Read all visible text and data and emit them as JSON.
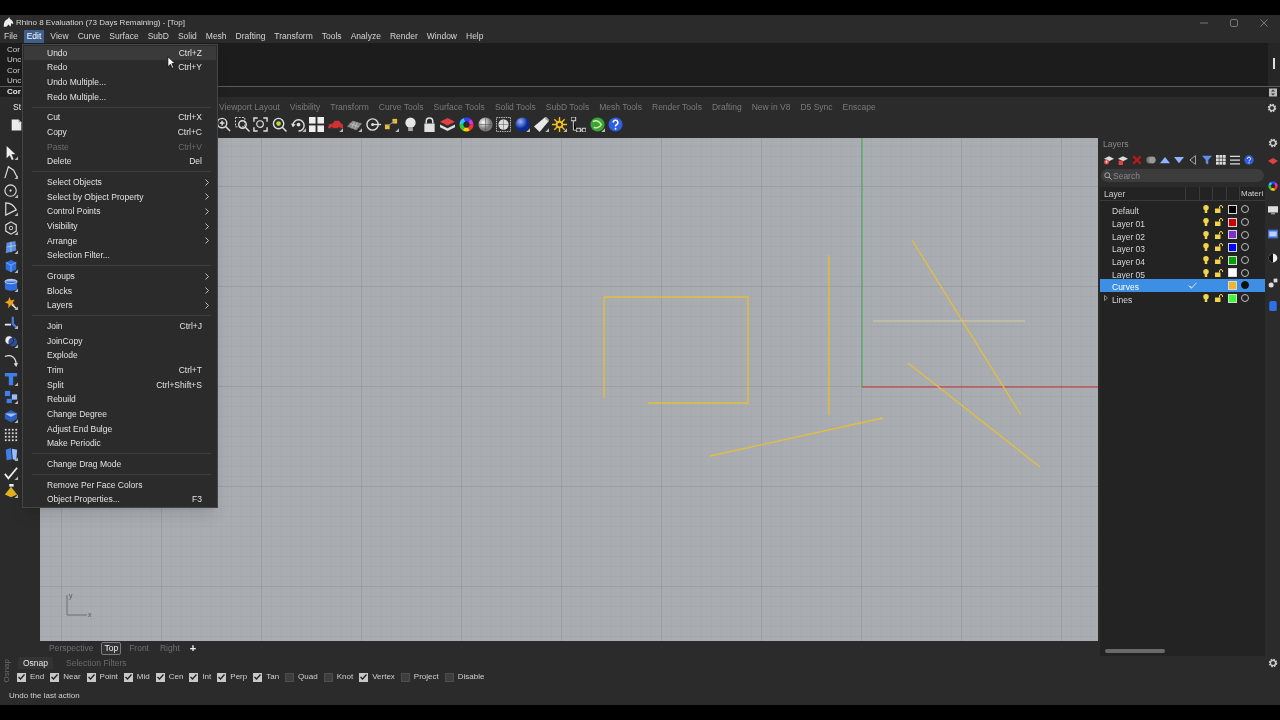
{
  "title_bar": {
    "title": "Rhino 8 Evaluation (73 Days Remaining) - [Top]"
  },
  "menu_bar": [
    {
      "label": "File",
      "selected": false
    },
    {
      "label": "Edit",
      "selected": true
    },
    {
      "label": "View",
      "selected": false
    },
    {
      "label": "Curve",
      "selected": false
    },
    {
      "label": "Surface",
      "selected": false
    },
    {
      "label": "SubD",
      "selected": false
    },
    {
      "label": "Solid",
      "selected": false
    },
    {
      "label": "Mesh",
      "selected": false
    },
    {
      "label": "Drafting",
      "selected": false
    },
    {
      "label": "Transform",
      "selected": false
    },
    {
      "label": "Tools",
      "selected": false
    },
    {
      "label": "Analyze",
      "selected": false
    },
    {
      "label": "Render",
      "selected": false
    },
    {
      "label": "Window",
      "selected": false
    },
    {
      "label": "Help",
      "selected": false
    }
  ],
  "command_history": {
    "lines": [
      "Cor",
      "Unc",
      "Cor",
      "Unc"
    ],
    "prompt": "Cor"
  },
  "toolbar_tabs": [
    {
      "label": "St",
      "selected": true
    },
    {
      "label": "Viewport Layout",
      "selected": false
    },
    {
      "label": "Visibility",
      "selected": false
    },
    {
      "label": "Transform",
      "selected": false
    },
    {
      "label": "Curve Tools",
      "selected": false
    },
    {
      "label": "Surface Tools",
      "selected": false
    },
    {
      "label": "Solid Tools",
      "selected": false
    },
    {
      "label": "SubD Tools",
      "selected": false
    },
    {
      "label": "Mesh Tools",
      "selected": false
    },
    {
      "label": "Render Tools",
      "selected": false
    },
    {
      "label": "Drafting",
      "selected": false
    },
    {
      "label": "New in V8",
      "selected": false
    },
    {
      "label": "D5 Sync",
      "selected": false
    },
    {
      "label": "Enscape",
      "selected": false
    }
  ],
  "edit_menu": {
    "groups": [
      [
        {
          "label": "Undo",
          "shortcut": "Ctrl+Z",
          "submenu": false,
          "disabled": false,
          "highlighted": true
        },
        {
          "label": "Redo",
          "shortcut": "Ctrl+Y",
          "submenu": false,
          "disabled": false,
          "highlighted": false
        },
        {
          "label": "Undo Multiple...",
          "submenu": false,
          "disabled": false,
          "highlighted": false
        },
        {
          "label": "Redo Multiple...",
          "submenu": false,
          "disabled": false,
          "highlighted": false
        }
      ],
      [
        {
          "label": "Cut",
          "shortcut": "Ctrl+X",
          "submenu": false,
          "disabled": false,
          "highlighted": false
        },
        {
          "label": "Copy",
          "shortcut": "Ctrl+C",
          "submenu": false,
          "disabled": false,
          "highlighted": false
        },
        {
          "label": "Paste",
          "shortcut": "Ctrl+V",
          "submenu": false,
          "disabled": true,
          "highlighted": false
        },
        {
          "label": "Delete",
          "shortcut": "Del",
          "submenu": false,
          "disabled": false,
          "highlighted": false
        }
      ],
      [
        {
          "label": "Select Objects",
          "submenu": true,
          "disabled": false,
          "highlighted": false
        },
        {
          "label": "Select by Object Property",
          "submenu": true,
          "disabled": false,
          "highlighted": false
        },
        {
          "label": "Control Points",
          "submenu": true,
          "disabled": false,
          "highlighted": false
        },
        {
          "label": "Visibility",
          "submenu": true,
          "disabled": false,
          "highlighted": false
        },
        {
          "label": "Arrange",
          "submenu": true,
          "disabled": false,
          "highlighted": false
        },
        {
          "label": "Selection Filter...",
          "submenu": false,
          "disabled": false,
          "highlighted": false
        }
      ],
      [
        {
          "label": "Groups",
          "submenu": true,
          "disabled": false,
          "highlighted": false
        },
        {
          "label": "Blocks",
          "submenu": true,
          "disabled": false,
          "highlighted": false
        },
        {
          "label": "Layers",
          "submenu": true,
          "disabled": false,
          "highlighted": false
        }
      ],
      [
        {
          "label": "Join",
          "shortcut": "Ctrl+J",
          "submenu": false,
          "disabled": false,
          "highlighted": false
        },
        {
          "label": "JoinCopy",
          "submenu": false,
          "disabled": false,
          "highlighted": false
        },
        {
          "label": "Explode",
          "submenu": false,
          "disabled": false,
          "highlighted": false
        },
        {
          "label": "Trim",
          "shortcut": "Ctrl+T",
          "submenu": false,
          "disabled": false,
          "highlighted": false
        },
        {
          "label": "Split",
          "shortcut": "Ctrl+Shift+S",
          "submenu": false,
          "disabled": false,
          "highlighted": false
        },
        {
          "label": "Rebuild",
          "submenu": false,
          "disabled": false,
          "highlighted": false
        },
        {
          "label": "Change Degree",
          "submenu": false,
          "disabled": false,
          "highlighted": false
        },
        {
          "label": "Adjust End Bulge",
          "submenu": false,
          "disabled": false,
          "highlighted": false
        },
        {
          "label": "Make Periodic",
          "submenu": false,
          "disabled": false,
          "highlighted": false
        }
      ],
      [
        {
          "label": "Change Drag Mode",
          "submenu": false,
          "disabled": false,
          "highlighted": false
        }
      ],
      [
        {
          "label": "Remove Per Face Colors",
          "submenu": false,
          "disabled": false,
          "highlighted": false
        },
        {
          "label": "Object Properties...",
          "shortcut": "F3",
          "submenu": false,
          "disabled": false,
          "highlighted": false
        }
      ]
    ]
  },
  "viewport": {
    "axis_icon": {
      "y": "y",
      "x": "x"
    },
    "tabs": [
      {
        "label": "Perspective",
        "selected": false
      },
      {
        "label": "Top",
        "selected": true
      },
      {
        "label": "Front",
        "selected": false
      },
      {
        "label": "Right",
        "selected": false
      }
    ],
    "add_tab": "+"
  },
  "layers_panel": {
    "title": "Layers",
    "search": {
      "placeholder": "Search"
    },
    "columns": [
      "Layer",
      "Materi"
    ],
    "layers": [
      {
        "name": "Default",
        "color": "#000000",
        "selected": false,
        "current": false,
        "bulb": true,
        "lock": true,
        "expandable": false
      },
      {
        "name": "Layer 01",
        "color": "#cc0000",
        "selected": false,
        "current": false,
        "bulb": true,
        "lock": true,
        "expandable": false
      },
      {
        "name": "Layer 02",
        "color": "#7d2fd0",
        "selected": false,
        "current": false,
        "bulb": true,
        "lock": true,
        "expandable": false
      },
      {
        "name": "Layer 03",
        "color": "#0000ff",
        "selected": false,
        "current": false,
        "bulb": true,
        "lock": true,
        "expandable": false
      },
      {
        "name": "Layer 04",
        "color": "#00a000",
        "selected": false,
        "current": false,
        "bulb": true,
        "lock": true,
        "expandable": false
      },
      {
        "name": "Layer 05",
        "color": "#ffffff",
        "selected": false,
        "current": false,
        "bulb": true,
        "lock": true,
        "expandable": false
      },
      {
        "name": "Curves",
        "color": "#f3b62b",
        "selected": true,
        "current": true,
        "bulb": false,
        "lock": false,
        "expandable": false
      },
      {
        "name": "Lines",
        "color": "#33ff33",
        "selected": false,
        "current": false,
        "bulb": true,
        "lock": true,
        "expandable": true
      }
    ]
  },
  "osnap_panel": {
    "side_label": "Osnap",
    "tabs": [
      {
        "label": "Osnap",
        "selected": true
      },
      {
        "label": "Selection Filters",
        "selected": false
      }
    ],
    "snaps": [
      {
        "label": "End",
        "checked": true
      },
      {
        "label": "Near",
        "checked": true
      },
      {
        "label": "Point",
        "checked": true
      },
      {
        "label": "Mid",
        "checked": true
      },
      {
        "label": "Cen",
        "checked": true
      },
      {
        "label": "Int",
        "checked": true
      },
      {
        "label": "Perp",
        "checked": true
      },
      {
        "label": "Tan",
        "checked": true
      },
      {
        "label": "Quad",
        "checked": false
      },
      {
        "label": "Knot",
        "checked": false
      },
      {
        "label": "Vertex",
        "checked": true
      },
      {
        "label": "Project",
        "checked": false
      },
      {
        "label": "Disable",
        "checked": false
      }
    ]
  },
  "status_bar": {
    "text": "Undo the last action"
  }
}
